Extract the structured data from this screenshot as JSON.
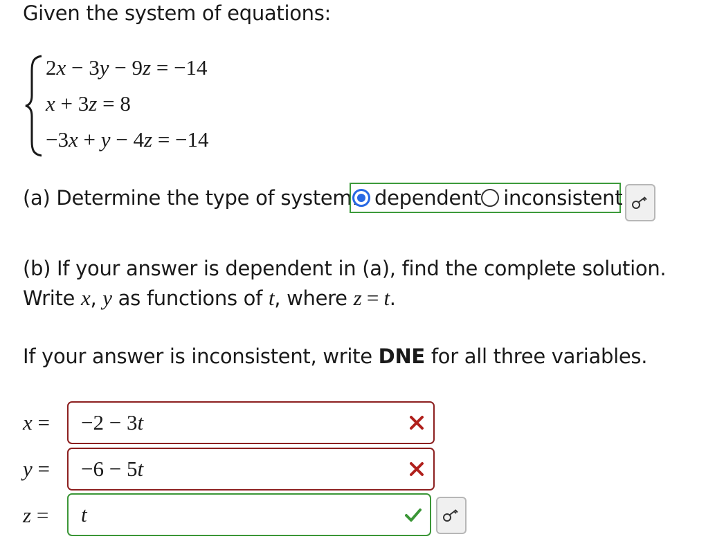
{
  "intro": "Given the system of equations:",
  "system": {
    "eq1": {
      "c1": "2",
      "v1": "x",
      "op1": "−",
      "c2": "3",
      "v2": "y",
      "op2": "−",
      "c3": "9",
      "v3": "z",
      "eq": "=",
      "rhs": "−14"
    },
    "eq2": {
      "v1": "x",
      "op1": "+",
      "c2": "3",
      "v2": "z",
      "eq": "=",
      "rhs": "8"
    },
    "eq3": {
      "c1": "−3",
      "v1": "x",
      "op1": "+",
      "v2": "y",
      "op2": "−",
      "c3": "4",
      "v3": "z",
      "eq": "=",
      "rhs": "−14"
    }
  },
  "part_a": {
    "prompt": "(a) Determine the type of system:",
    "options": [
      {
        "label": "dependent",
        "selected": true
      },
      {
        "label": "inconsistent",
        "selected": false
      }
    ]
  },
  "part_b": {
    "line1": "(b) If your answer is dependent in (a), find the complete solution.",
    "line2_pre": "Write ",
    "line2_x": "x",
    "line2_comma": ", ",
    "line2_y": "y",
    "line2_mid": " as functions of ",
    "line2_t": "t",
    "line2_where": ", where ",
    "line2_z": "z",
    "line2_eq": " = ",
    "line2_t2": "t",
    "line2_end": ".",
    "dne_pre": "If your answer is inconsistent, write ",
    "dne_bold": "DNE",
    "dne_post": " for all three variables."
  },
  "answers": {
    "x": {
      "var": "x",
      "eq": "=",
      "value": "−2 − 3",
      "t": "t",
      "status": "incorrect"
    },
    "y": {
      "var": "y",
      "eq": "=",
      "value": "−6 − 5",
      "t": "t",
      "status": "incorrect"
    },
    "z": {
      "var": "z",
      "eq": "=",
      "value": "",
      "t": "t",
      "status": "correct"
    }
  },
  "colors": {
    "correct": "#3b9637",
    "incorrect": "#8c1f1f",
    "radio": "#2869e4",
    "wrong_mark": "#b0201c"
  },
  "icons": {
    "key": "key-icon",
    "check": "check-icon",
    "cross": "cross-icon"
  }
}
